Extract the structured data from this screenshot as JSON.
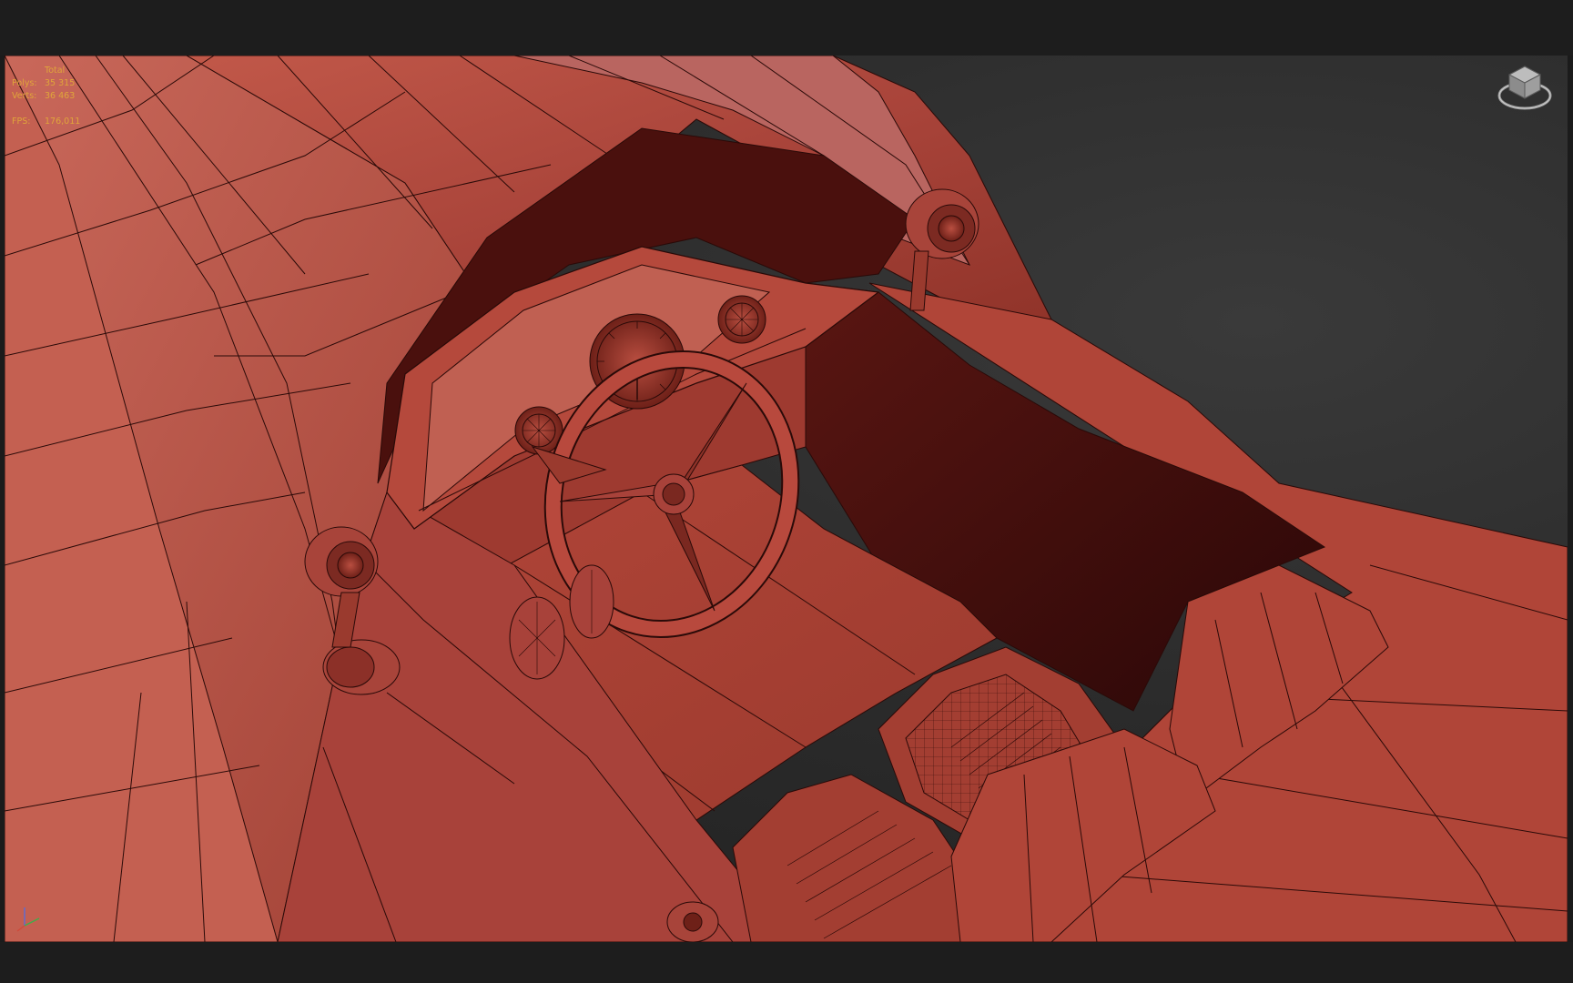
{
  "stats": {
    "header": "Total",
    "polys_label": "Polys:",
    "polys_value": "35 315",
    "verts_label": "Verts:",
    "verts_value": "36 463",
    "fps_label": "FPS:",
    "fps_value": "176,011"
  },
  "colors": {
    "body_red": "#b2473a",
    "body_highlight": "#c55a4a",
    "shadow": "#3a0e0c",
    "wire": "#2a0a08",
    "stats_text": "#e0a53a",
    "viewport_bg": "#2b2b2b"
  },
  "icons": {
    "viewcube": "viewcube-icon",
    "axis": "axis-tripod-icon"
  }
}
